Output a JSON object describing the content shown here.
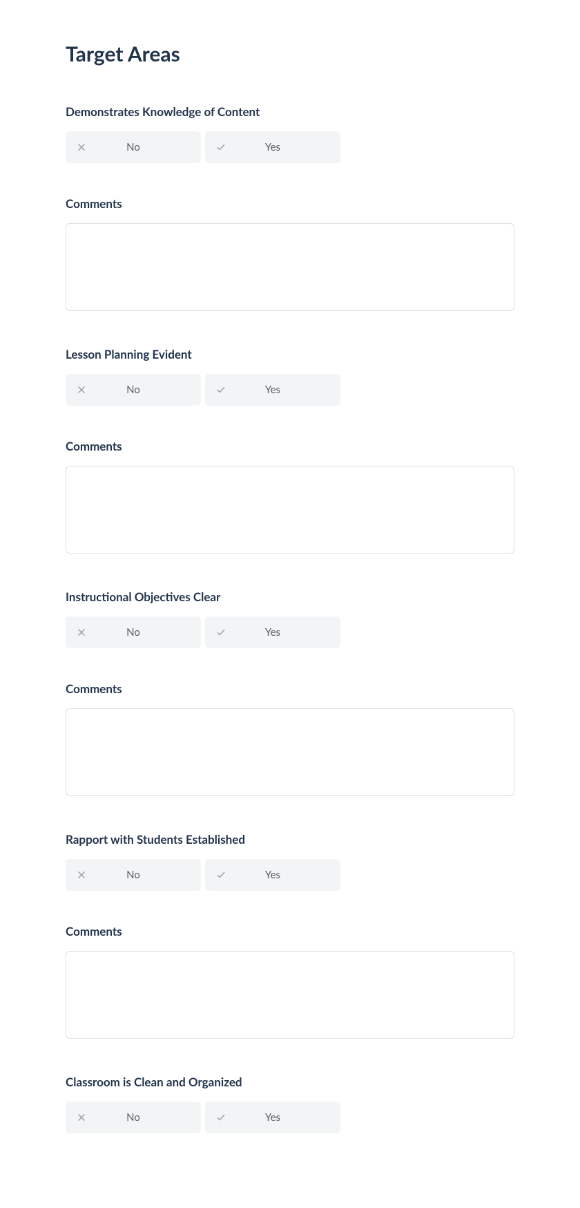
{
  "page_title": "Target Areas",
  "labels": {
    "no": "No",
    "yes": "Yes",
    "comments": "Comments"
  },
  "sections": [
    {
      "heading": "Demonstrates Knowledge of Content",
      "has_comments": true
    },
    {
      "heading": "Lesson Planning Evident",
      "has_comments": true
    },
    {
      "heading": "Instructional Objectives Clear",
      "has_comments": true
    },
    {
      "heading": "Rapport with Students Established",
      "has_comments": true
    },
    {
      "heading": "Classroom is Clean and Organized",
      "has_comments": false
    }
  ]
}
